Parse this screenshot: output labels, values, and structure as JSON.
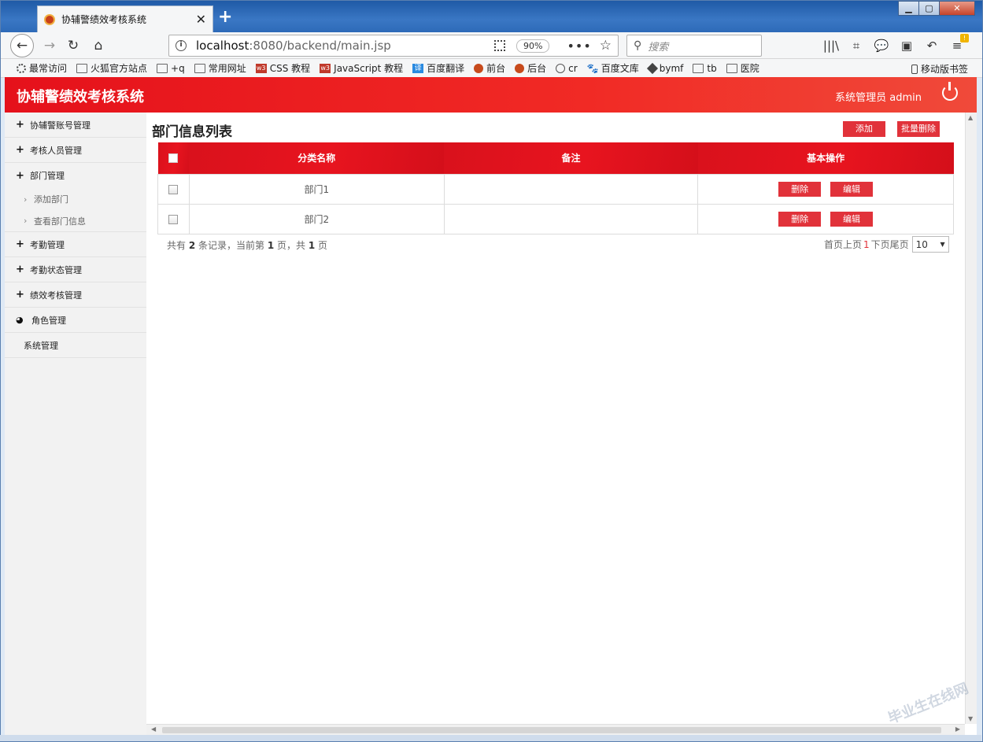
{
  "browser": {
    "tab_title": "协辅警绩效考核系统",
    "url_host": "localhost",
    "url_rest": ":8080/backend/main.jsp",
    "zoom": "90%",
    "search_placeholder": "搜索",
    "bookmarks": [
      {
        "label": "最常访问",
        "icon": "gear"
      },
      {
        "label": "火狐官方站点",
        "icon": "folder"
      },
      {
        "label": "+q",
        "icon": "folder"
      },
      {
        "label": "常用网址",
        "icon": "folder"
      },
      {
        "label": "CSS 教程",
        "icon": "w3"
      },
      {
        "label": "JavaScript 教程",
        "icon": "w3"
      },
      {
        "label": "百度翻译",
        "icon": "yi"
      },
      {
        "label": "前台",
        "icon": "red"
      },
      {
        "label": "后台",
        "icon": "red"
      },
      {
        "label": "cr",
        "icon": "globe"
      },
      {
        "label": "百度文库",
        "icon": "paw"
      },
      {
        "label": "bymf",
        "icon": "cube"
      },
      {
        "label": "tb",
        "icon": "folder"
      },
      {
        "label": "医院",
        "icon": "folder"
      }
    ],
    "mobile_bookmarks": "移动版书签"
  },
  "header": {
    "title": "协辅警绩效考核系统",
    "user": "系统管理员 admin"
  },
  "sidebar": {
    "items": [
      {
        "label": "协辅警账号管理"
      },
      {
        "label": "考核人员管理"
      },
      {
        "label": "部门管理"
      },
      {
        "label": "添加部门"
      },
      {
        "label": "查看部门信息"
      },
      {
        "label": "考勤管理"
      },
      {
        "label": "考勤状态管理"
      },
      {
        "label": "绩效考核管理"
      },
      {
        "label": "角色管理"
      },
      {
        "label": "系统管理"
      }
    ]
  },
  "main": {
    "title": "部门信息列表",
    "add_label": "添加",
    "batch_delete_label": "批量删除",
    "columns": [
      "分类名称",
      "备注",
      "基本操作"
    ],
    "rows": [
      {
        "name": "部门1",
        "remark": ""
      },
      {
        "name": "部门2",
        "remark": ""
      }
    ],
    "delete_label": "删除",
    "edit_label": "编辑",
    "pager": {
      "p1": "共有 ",
      "total": "2",
      "p2": " 条记录，当前第 ",
      "current": "1",
      "p3": " 页，共 ",
      "pages": "1",
      "p4": " 页",
      "first_prev": "首页上页",
      "page_num": "1",
      "next_last": "下页尾页",
      "page_size": "10"
    }
  },
  "watermark": "毕业生在线网"
}
